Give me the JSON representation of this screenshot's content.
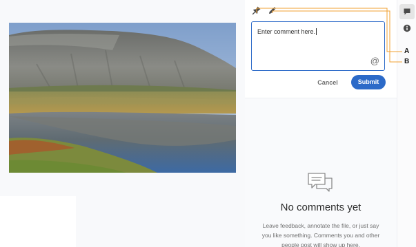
{
  "document": {
    "image_alt": "Mountain and lake landscape photo"
  },
  "toolbar": {
    "pin_icon": "pin-icon",
    "pencil_icon": "pencil-icon"
  },
  "comment_form": {
    "value": "Enter comment here.",
    "mention_label": "@",
    "cancel_label": "Cancel",
    "submit_label": "Submit"
  },
  "empty_state": {
    "icon": "chat-bubbles-icon",
    "title": "No comments yet",
    "description": "Leave feedback, annotate the file, or just say you like something. Comments you and other people post will show up here."
  },
  "rail": {
    "comments_icon": "comment-icon",
    "info_icon": "info-icon"
  },
  "callouts": {
    "a": "A",
    "b": "B"
  },
  "colors": {
    "accent": "#2c6ac8",
    "callout_line": "#f0a030"
  }
}
